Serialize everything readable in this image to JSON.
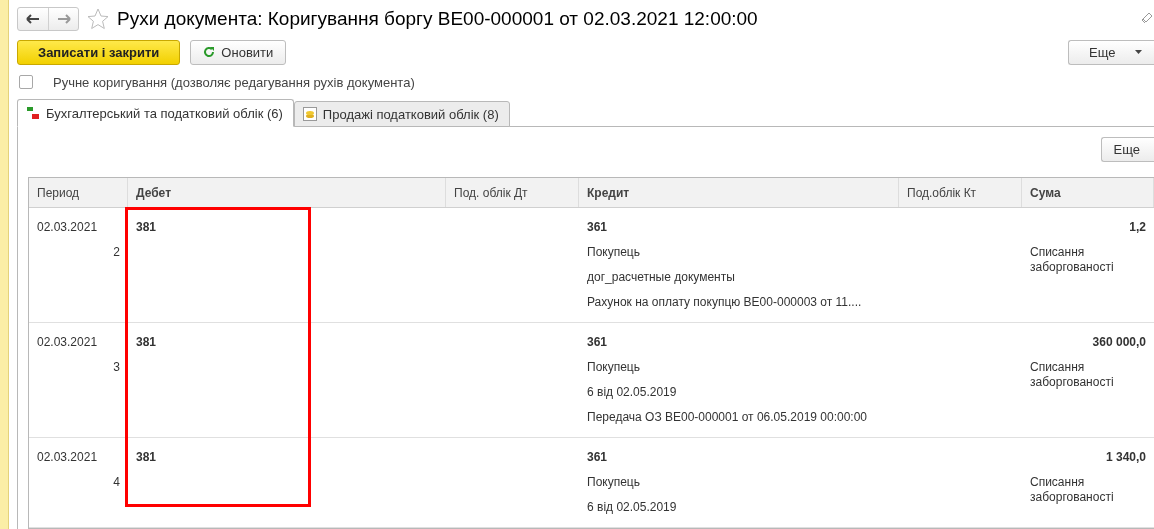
{
  "window": {
    "title": "Рухи документа: Коригування боргу ВЕ00-000001 от 02.03.2021 12:00:00"
  },
  "toolbar": {
    "primary": "Записати і закрити",
    "refresh": "Оновити",
    "more": "Еще"
  },
  "manual_edit": {
    "label": "Ручне коригування (дозволяє редагування рухів документа)",
    "checked": false
  },
  "tabs": [
    {
      "label": "Бухгалтерський та податковий облік (6)",
      "selected": true,
      "kind": "dtkt"
    },
    {
      "label": "Продажі податковий облік (8)",
      "selected": false,
      "kind": "coins"
    }
  ],
  "panel_more": "Еще",
  "table": {
    "columns": [
      "Период",
      "Дебет",
      "Под. облік Дт",
      "Кредит",
      "Под.облік Кт",
      "Сума"
    ],
    "rows": [
      {
        "period": "02.03.2021",
        "number": "2",
        "debit": "381",
        "credit": [
          "361",
          "Покупець",
          "дог_расчетные документы",
          "Рахунок на оплату покупцю ВЕ00-000003 от 11...."
        ],
        "amount": "1,2",
        "content": "Списання заборгованості"
      },
      {
        "period": "02.03.2021",
        "number": "3",
        "debit": "381",
        "credit": [
          "361",
          "Покупець",
          "6 від 02.05.2019",
          "Передача ОЗ ВЕ00-000001 от 06.05.2019 00:00:00"
        ],
        "amount": "360 000,0",
        "content": "Списання заборгованості"
      },
      {
        "period": "02.03.2021",
        "number": "4",
        "debit": "381",
        "credit": [
          "361",
          "Покупець",
          "6 від 02.05.2019"
        ],
        "amount": "1 340,0",
        "content": "Списання заборгованості"
      }
    ]
  }
}
